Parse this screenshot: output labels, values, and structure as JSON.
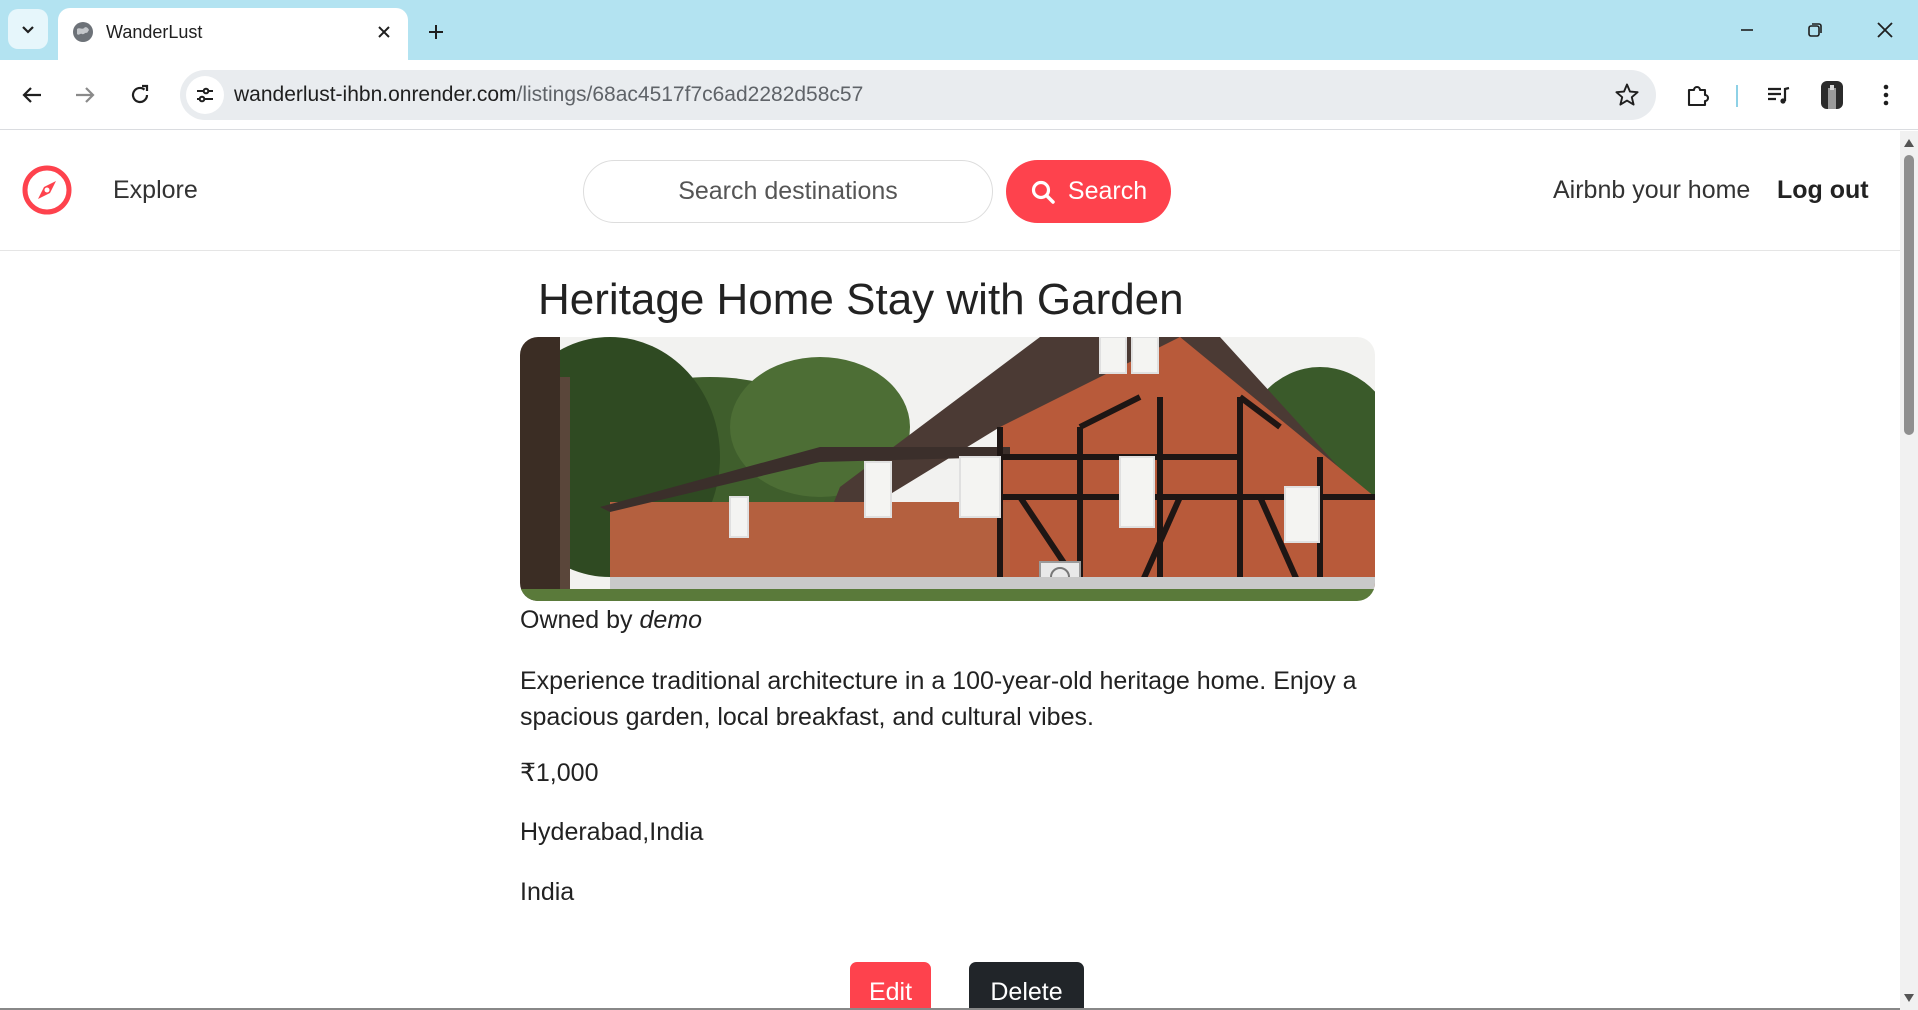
{
  "browser": {
    "tab_title": "WanderLust",
    "url_host": "wanderlust-ihbn.onrender.com",
    "url_path": "/listings/68ac4517f7c6ad2282d58c57"
  },
  "navbar": {
    "explore_label": "Explore",
    "search_placeholder": "Search destinations",
    "search_button_label": "Search",
    "host_link_label": "Airbnb your home",
    "logout_label": "Log out",
    "brand_color": "#fe424d"
  },
  "listing": {
    "title": "Heritage Home Stay with Garden",
    "owner_prefix": "Owned by",
    "owner_name": "demo",
    "description": "Experience traditional architecture in a 100-year-old heritage home. Enjoy a spacious garden, local breakfast, and cultural vibes.",
    "price": "₹1,000",
    "location": "Hyderabad,India",
    "country": "India",
    "edit_label": "Edit",
    "delete_label": "Delete"
  }
}
